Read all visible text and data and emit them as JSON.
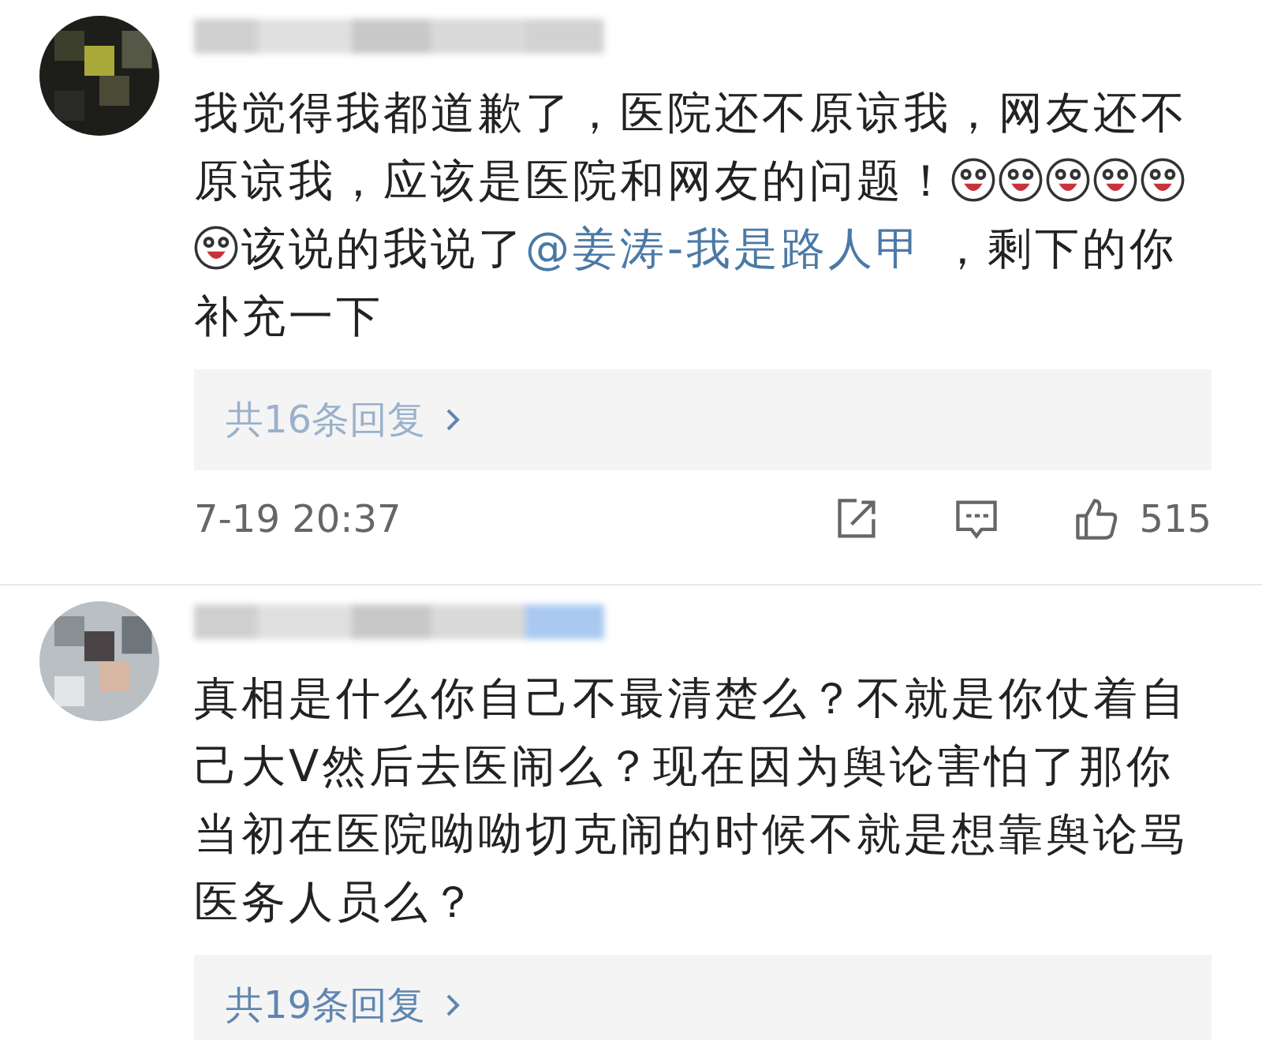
{
  "comments": [
    {
      "parts": [
        {
          "kind": "text",
          "text": "我觉得我都道歉了，医院还不原谅我，网友还不原谅我，应该是医院和网友的问题！"
        },
        {
          "kind": "emoji"
        },
        {
          "kind": "emoji"
        },
        {
          "kind": "emoji"
        },
        {
          "kind": "emoji"
        },
        {
          "kind": "emoji"
        },
        {
          "kind": "emoji"
        },
        {
          "kind": "text",
          "text": "该说的我说了"
        },
        {
          "kind": "mention",
          "text": "@姜涛-我是路人甲"
        },
        {
          "kind": "text",
          "text": " ，剩下的你补充一下"
        }
      ],
      "replies": "共16条回复",
      "time": "7-19 20:37",
      "likes": "515"
    },
    {
      "parts": [
        {
          "kind": "text",
          "text": "真相是什么你自己不最清楚么？不就是你仗着自己大V然后去医闹么？现在因为舆论害怕了那你当初在医院呦呦切克闹的时候不就是想靠舆论骂医务人员么？"
        }
      ],
      "replies": "共19条回复"
    }
  ]
}
